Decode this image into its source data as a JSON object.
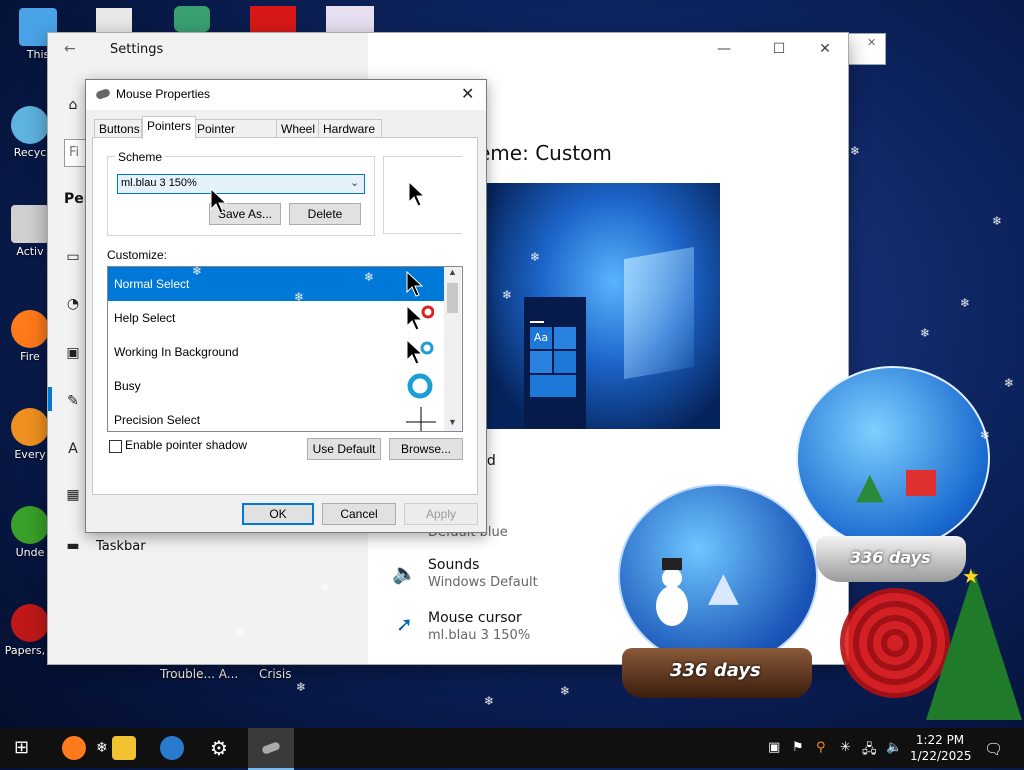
{
  "desktop": {
    "icons": [
      {
        "label": "This",
        "color": "#4aa3e6"
      },
      {
        "label": "Recyc",
        "color": "#5fb3e0"
      },
      {
        "label": "Activ",
        "color": "#d0d0d0"
      },
      {
        "label": "Fire",
        "color": "#ff7a1a"
      },
      {
        "label": "Every",
        "color": "#f09020"
      },
      {
        "label": "Unde",
        "color": "#39a029"
      },
      {
        "label": "Papers, P",
        "color": "#c01818"
      }
    ],
    "bottom_labels": [
      "Trouble... A...",
      "Crisis"
    ]
  },
  "settings": {
    "title": "Settings",
    "search_placeholder": "Fi",
    "section_partial": "Per",
    "heading_partial": "eme: Custom",
    "background_partial": "nd",
    "color_value_partial": "Default blue",
    "taskbar_label": "Taskbar",
    "sounds": {
      "label": "Sounds",
      "value": "Windows Default"
    },
    "mouse_cursor": {
      "label": "Mouse cursor",
      "value": "ml.blau 3 150%"
    },
    "preview_tile_text": "Aa"
  },
  "mouse_dialog": {
    "title": "Mouse Properties",
    "tabs": [
      "Buttons",
      "Pointers",
      "Pointer Options",
      "Wheel",
      "Hardware"
    ],
    "active_tab": "Pointers",
    "scheme_label": "Scheme",
    "scheme_value": "ml.blau 3 150%",
    "save_as": "Save As...",
    "delete": "Delete",
    "customize_label": "Customize:",
    "pointers": [
      "Normal Select",
      "Help Select",
      "Working In Background",
      "Busy",
      "Precision Select"
    ],
    "selected_pointer": "Normal Select",
    "shadow_label": "Enable pointer shadow",
    "use_default": "Use Default",
    "browse": "Browse...",
    "ok": "OK",
    "cancel": "Cancel",
    "apply": "Apply"
  },
  "taskbar": {
    "time": "1:22 PM",
    "date": "1/22/2025"
  },
  "widgets": {
    "snow_globe_1": "336 days",
    "snow_globe_2": "336 days"
  },
  "colors": {
    "accent": "#0078d7",
    "desktop": "#0d2460"
  }
}
